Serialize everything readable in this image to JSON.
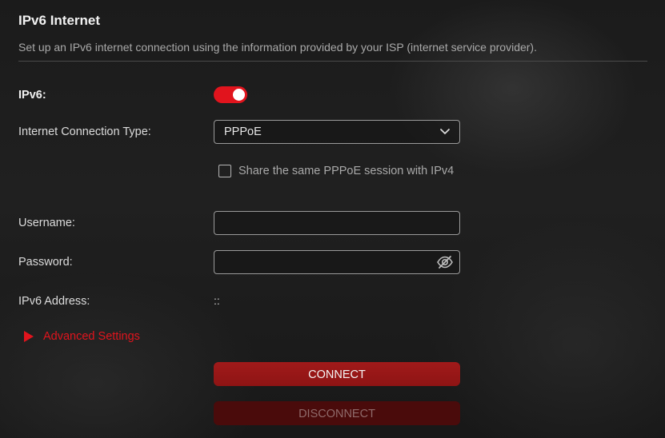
{
  "page": {
    "title": "IPv6 Internet",
    "description": "Set up an IPv6 internet connection using the information provided by your ISP (internet service provider)."
  },
  "form": {
    "ipv6": {
      "label": "IPv6:",
      "enabled": true
    },
    "connection_type": {
      "label": "Internet Connection Type:",
      "value": "PPPoE"
    },
    "share_session": {
      "label": "Share the same PPPoE session with IPv4",
      "checked": false
    },
    "username": {
      "label": "Username:",
      "value": "",
      "placeholder": ""
    },
    "password": {
      "label": "Password:",
      "value": "",
      "placeholder": ""
    },
    "ipv6_address": {
      "label": "IPv6 Address:",
      "value": "::"
    },
    "advanced": {
      "label": "Advanced Settings"
    }
  },
  "buttons": {
    "connect": "CONNECT",
    "disconnect": "DISCONNECT"
  },
  "colors": {
    "accent": "#e1141d",
    "connect_bg": "#961717",
    "disconnect_bg": "#4a0b0b"
  },
  "icons": {
    "dropdown": "chevron-down-icon",
    "password_visibility": "eye-off-icon",
    "advanced_toggle": "triangle-right-icon"
  }
}
